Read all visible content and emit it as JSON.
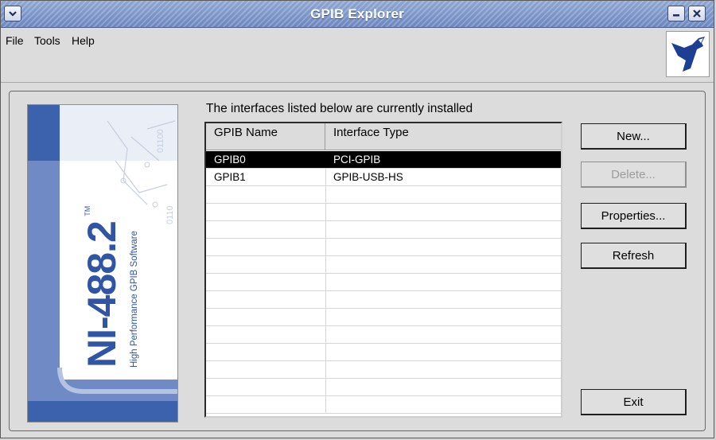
{
  "window": {
    "title": "GPIB Explorer"
  },
  "menu": {
    "file": "File",
    "tools": "Tools",
    "help": "Help"
  },
  "banner": {
    "product": "NI-488.2",
    "trademark": "TM",
    "tagline": "High Performance GPIB Software"
  },
  "interfaces": {
    "heading": "The interfaces listed below are currently installed",
    "columns": [
      "GPIB Name",
      "Interface Type"
    ],
    "rows": [
      {
        "name": "GPIB0",
        "type": "PCI-GPIB",
        "selected": true
      },
      {
        "name": "GPIB1",
        "type": "GPIB-USB-HS",
        "selected": false
      }
    ]
  },
  "buttons": {
    "new": "New...",
    "delete": "Delete...",
    "properties": "Properties...",
    "refresh": "Refresh",
    "exit": "Exit"
  },
  "colors": {
    "titlebar": "#7a93c8",
    "selection": "#000000",
    "banner_blue": "#2f55a4",
    "banner_light": "#d6dff0"
  },
  "icons": {
    "window_menu": "chevron-down-icon",
    "minimize": "minimize-icon",
    "close": "close-icon",
    "ni_logo": "ni-eagle-logo"
  }
}
